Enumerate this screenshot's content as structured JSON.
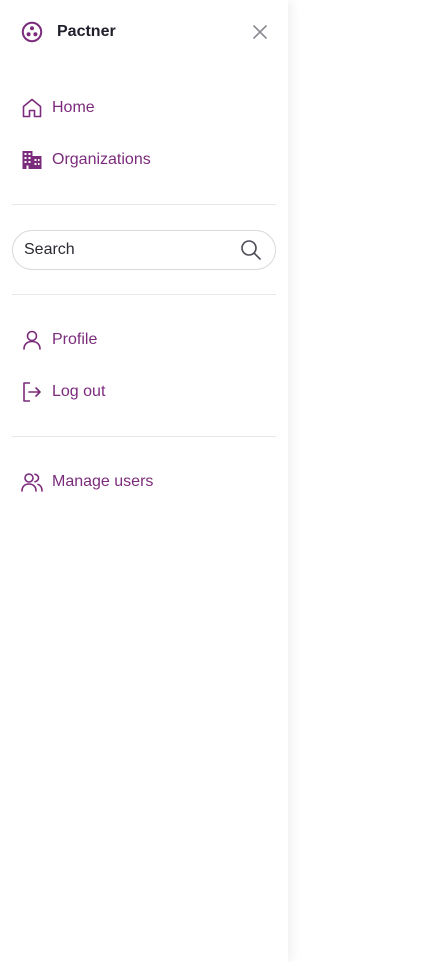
{
  "brand": {
    "name": "Pactner",
    "logo_icon": "pactner-logo-icon",
    "close_icon": "close-icon"
  },
  "nav_primary": [
    {
      "label": "Home",
      "icon": "home-icon"
    },
    {
      "label": "Organizations",
      "icon": "building-icon"
    }
  ],
  "search": {
    "placeholder": "Search",
    "value": "",
    "icon": "search-icon"
  },
  "nav_account": [
    {
      "label": "Profile",
      "icon": "user-icon"
    },
    {
      "label": "Log out",
      "icon": "logout-icon"
    }
  ],
  "nav_admin": [
    {
      "label": "Manage users",
      "icon": "users-icon"
    }
  ],
  "colors": {
    "accent": "#7b2b7b",
    "brand_text": "#1f1f2b",
    "divider": "#e8e8ec"
  }
}
